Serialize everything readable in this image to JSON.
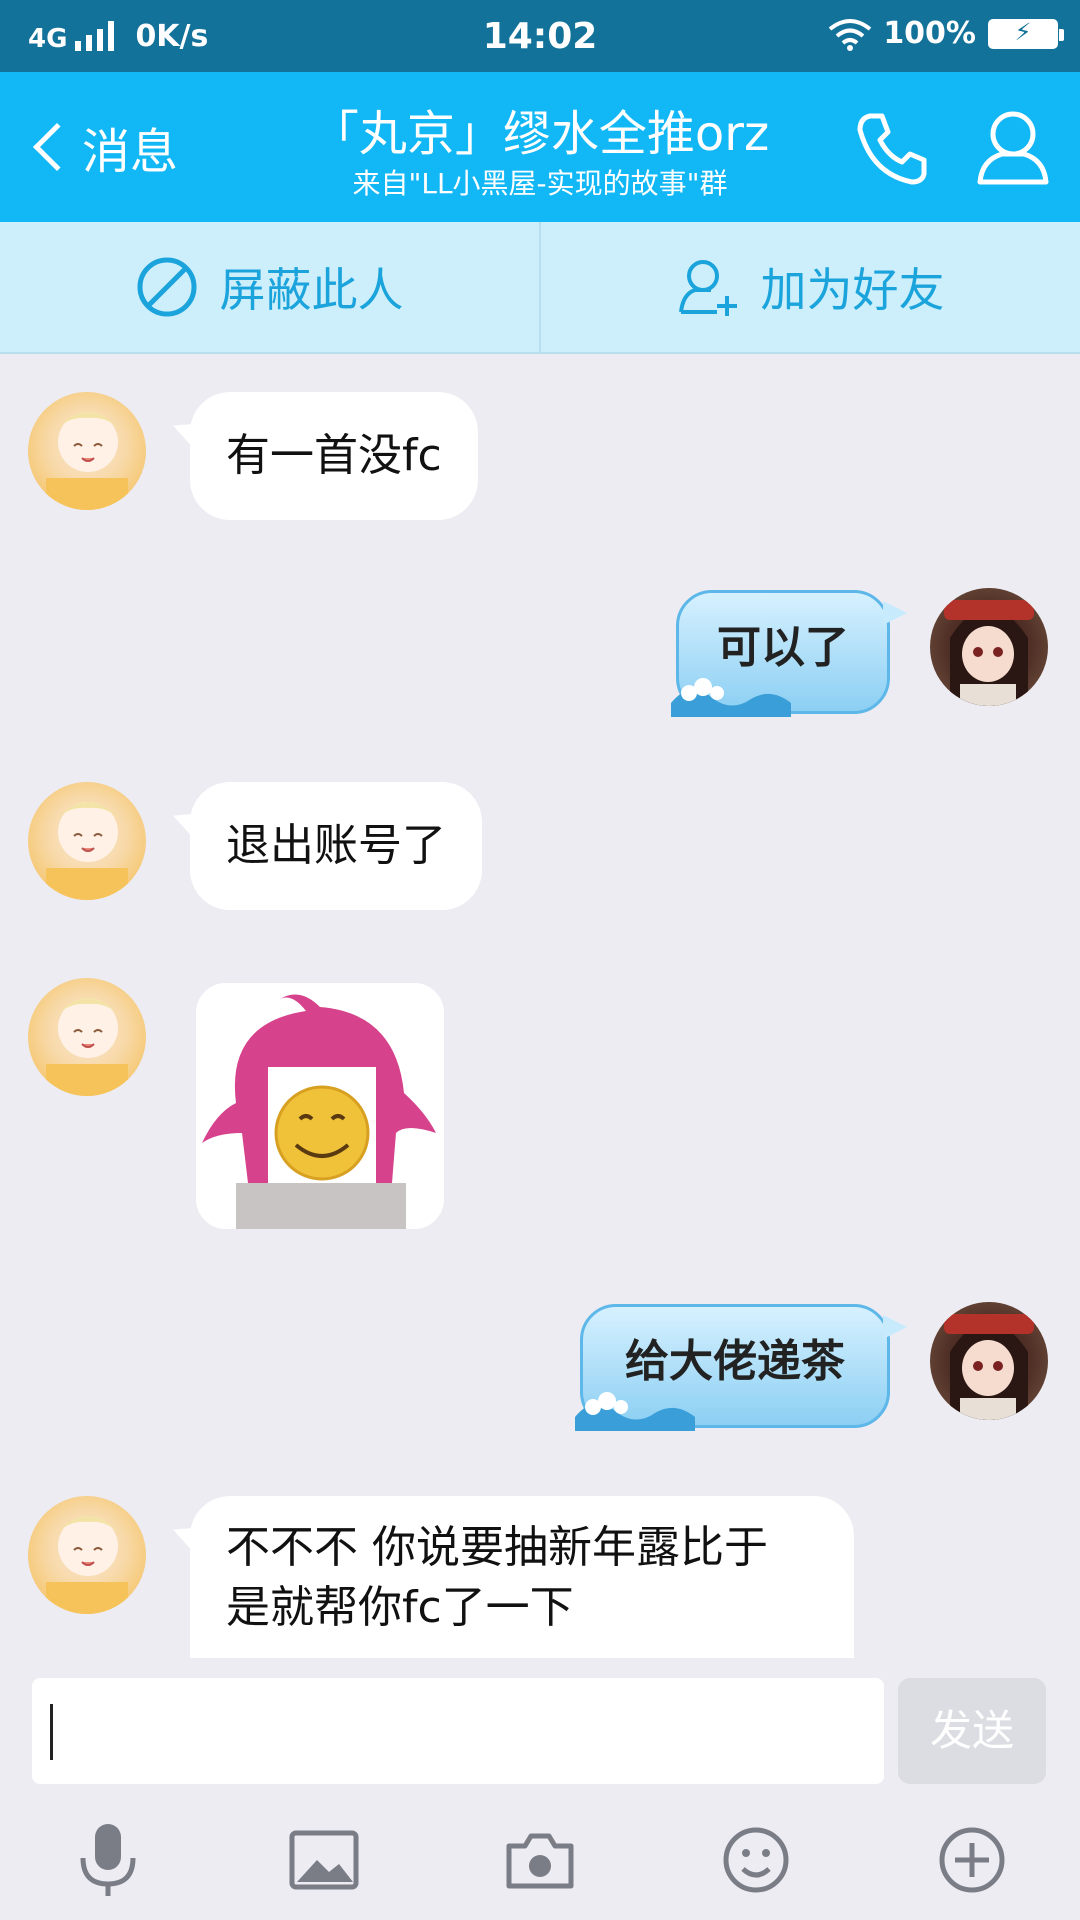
{
  "status_bar": {
    "network": "4G",
    "speed": "0K/s",
    "time": "14:02",
    "battery": "100%"
  },
  "header": {
    "back_label": "消息",
    "title": "「丸京」缪水全推orz",
    "subtitle": "来自\"LL小黑屋-实现的故事\"群"
  },
  "actions": {
    "block_label": "屏蔽此人",
    "add_friend_label": "加为好友"
  },
  "messages": [
    {
      "direction": "in",
      "text": "有一首没fc"
    },
    {
      "direction": "out",
      "text": "可以了"
    },
    {
      "direction": "in",
      "text": "退出账号了"
    },
    {
      "direction": "in",
      "type": "sticker"
    },
    {
      "direction": "out",
      "text": "给大佬递茶"
    },
    {
      "direction": "in",
      "line1": "不不不 你说要抽新年露比于",
      "line2": "是就帮你fc了一下"
    }
  ],
  "composer": {
    "send_label": "发送"
  },
  "toolbar": [
    "mic-icon",
    "image-icon",
    "camera-icon",
    "emoji-icon",
    "plus-icon"
  ],
  "colors": {
    "status_bar": "#12729a",
    "header": "#12b7f5",
    "action_bar": "#cdeffb",
    "action_text": "#1ba3dc",
    "background": "#ececf2"
  }
}
